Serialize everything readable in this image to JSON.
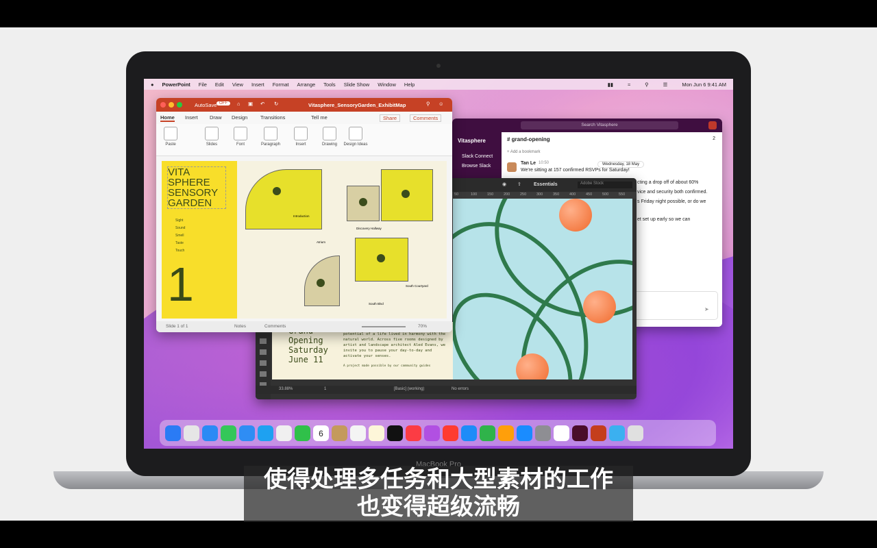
{
  "menubar": {
    "items": [
      "PowerPoint",
      "File",
      "Edit",
      "View",
      "Insert",
      "Format",
      "Arrange",
      "Tools",
      "Slide Show",
      "Window",
      "Help"
    ],
    "datetime": "Mon Jun 6  9:41 AM"
  },
  "powerpoint": {
    "autosave": "AutoSave",
    "autosave_state": "OFF",
    "doc_title": "Vitasphere_SensoryGarden_ExhibitMap",
    "tabs": [
      "Home",
      "Insert",
      "Draw",
      "Design",
      "Transitions",
      "Tell me"
    ],
    "share": "Share",
    "comments": "Comments",
    "ribbon": [
      "Paste",
      "Slides",
      "Font",
      "Paragraph",
      "Insert",
      "Drawing",
      "Design Ideas"
    ],
    "slide_title": "VITA SPHERE SENSORY GARDEN",
    "senses": [
      "Sight",
      "Sound",
      "Smell",
      "Taste",
      "Touch"
    ],
    "slide_number": "1",
    "rooms": [
      "Introduction",
      "Sitting Area",
      "Discovery Hallway",
      "Atrium",
      "Reception",
      "South Courtyard",
      "South Blvd",
      "Pool St."
    ],
    "status_left": "Slide 1 of 1",
    "notes": "Notes",
    "status_comments": "Comments",
    "zoom": "70%"
  },
  "slack": {
    "search": "Search Vitasphere",
    "workspace": "Vitasphere",
    "sidebar": [
      "Slack Connect",
      "Browse Slack"
    ],
    "channel": "# grand-opening",
    "member_count": "2",
    "bookmark": "+ Add a bookmark",
    "author": "Tan Le",
    "time": "10:50",
    "date_chip": "Wednesday, 18 May",
    "message": "We're sitting at 157 confirmed RSVPs for Saturday!",
    "lines": [
      "cting a drop off of about 60%",
      "vice and security both confirmed.",
      "s Friday night possible, or do we",
      "et set up early so we can"
    ]
  },
  "illustrator": {
    "workspace": "Essentials",
    "search": "Adobe Stock",
    "ruler": [
      "50",
      "100",
      "150",
      "200",
      "250",
      "300",
      "350",
      "400",
      "450",
      "500",
      "550",
      "600",
      "650",
      "700",
      "750",
      "800",
      "850",
      "900",
      "950",
      "1000",
      "1050",
      "1100",
      "1150",
      "1200",
      "1250",
      "1300",
      "1350"
    ],
    "card_title": "Grand Opening Saturday June 11",
    "card_body": "An immersive experience celebrating the potential of a life lived in harmony with the natural world. Across five rooms designed by artist and landscape architect Aled Evans, we invite you to pause your day-to-day and activate your senses.",
    "card_foot": "A project made possible by our community guides",
    "zoom": "33.88%",
    "page": "1",
    "mode": "[Basic] (working)",
    "errors": "No errors"
  },
  "bezel_label": "MacBook Pro",
  "subtitle": {
    "line1": "使得处理多任务和大型素材的工作",
    "line2": "也变得超级流畅"
  },
  "dock_colors": [
    "#2a7bf5",
    "#e6e6e6",
    "#2a8af5",
    "#34c759",
    "#2f8df4",
    "#1ea1f1",
    "#f0f0f0",
    "#30c04a",
    "#ffffff",
    "#c49a5c",
    "#f4f4f4",
    "#fdf6d9",
    "#111111",
    "#fc3c44",
    "#b150e2",
    "#ff3b30",
    "#1d8cf8",
    "#2fb34a",
    "#ff9f0a",
    "#1a8cff",
    "#8e8e93",
    "#ffffff",
    "#4a0d2a",
    "#c43e1c",
    "#3bb0f0",
    "#e0e0e0"
  ],
  "dock_names": [
    "finder-icon",
    "launchpad-icon",
    "safari-icon",
    "messages-icon",
    "mail-icon",
    "maps-icon",
    "photos-icon",
    "facetime-icon",
    "calendar-icon",
    "notes-brown-icon",
    "reminders-icon",
    "notes-icon",
    "appletv-icon",
    "music-icon",
    "podcasts-icon",
    "news-icon",
    "keynote-icon",
    "numbers-icon",
    "pages-icon",
    "appstore-icon",
    "settings-icon",
    "slack-icon",
    "indesign-icon",
    "powerpoint-icon",
    "folder-icon",
    "trash-icon"
  ],
  "dock_label_calendar": "6"
}
